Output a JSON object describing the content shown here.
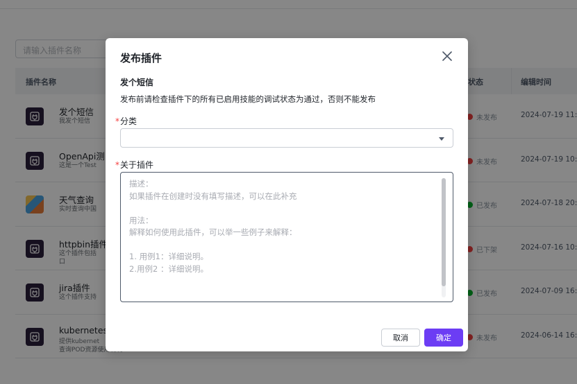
{
  "background": {
    "search_placeholder": "请输入插件名称",
    "columns": {
      "name": "插件名称",
      "status": "状态",
      "time": "编辑时间"
    },
    "rows": [
      {
        "title": "发个短信",
        "desc": "我发个短信",
        "status": "未发布",
        "status_color": "#f53f3f",
        "time": "2024-07-19 11:4",
        "icon": "plugin-icon"
      },
      {
        "title": "OpenApi测",
        "desc": "这是一个Test",
        "status": "未发布",
        "status_color": "#f53f3f",
        "time": "2024-07-19 10:4",
        "icon": "plugin-icon"
      },
      {
        "title": "天气查询",
        "desc": "实时查询中国",
        "status": "已发布",
        "status_color": "#00b42a",
        "time": "2024-07-18 20:2",
        "icon": "weather-icon"
      },
      {
        "title": "httpbin插件",
        "desc": "这个插件包括\n口",
        "status": "已下架",
        "status_color": "#f53f3f",
        "time": "2024-07-16 10:5",
        "icon": "plugin-icon"
      },
      {
        "title": "jira插件",
        "desc": "这个插件支持",
        "status": "已发布",
        "status_color": "#00b42a",
        "time": "2024-07-09 16:0",
        "icon": "plugin-icon"
      },
      {
        "title": "kubernetes:",
        "desc": "提供kubernet\n查询POD资源使用情况",
        "status": "未发布",
        "status_color": "#f53f3f",
        "time": "2024-06-14 16:1",
        "icon": "plugin-icon"
      }
    ]
  },
  "dialog": {
    "title": "发布插件",
    "plugin_name": "发个短信",
    "notice": "发布前请检查插件下的所有已启用技能的调试状态为通过，否则不能发布",
    "required_mark": "*",
    "category_label": "分类",
    "category_value": "",
    "about_label": "关于插件",
    "about_placeholder": "描述：\n如果插件在创建时没有填写描述，可以在此补充\n\n用法：\n解释如何使用此插件，可以举一些例子来解释：\n\n1. 用例1：详细说明。\n2.用例2 ：详细说明。",
    "cancel_label": "取消",
    "ok_label": "确定",
    "accent_color": "#6c3df4"
  }
}
